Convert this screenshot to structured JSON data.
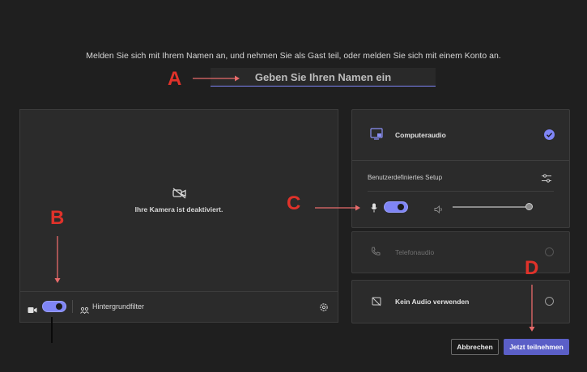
{
  "intro_text": "Melden Sie sich mit Ihrem Namen an, und nehmen Sie als Gast teil, oder melden Sie sich mit einem Konto an.",
  "name_input": {
    "placeholder": "Geben Sie Ihren Namen ein",
    "value": ""
  },
  "markers": {
    "a": "A",
    "b": "B",
    "c": "C",
    "d": "D"
  },
  "camera": {
    "status_text": "Ihre Kamera ist deaktiviert.",
    "toggle_on": true,
    "background_filter_label": "Hintergrundfilter"
  },
  "audio": {
    "computer_audio_label": "Computeraudio",
    "computer_audio_selected": true,
    "custom_setup_label": "Benutzerdefiniertes Setup",
    "mic_toggle_on": true,
    "speaker_volume": 0.8,
    "phone_audio_label": "Telefonaudio",
    "no_audio_label": "Kein Audio verwenden"
  },
  "buttons": {
    "cancel": "Abbrechen",
    "join": "Jetzt teilnehmen"
  },
  "colors": {
    "accent": "#7f85f5",
    "primary_button": "#5b5fc7",
    "annotation": "#e0322a"
  }
}
